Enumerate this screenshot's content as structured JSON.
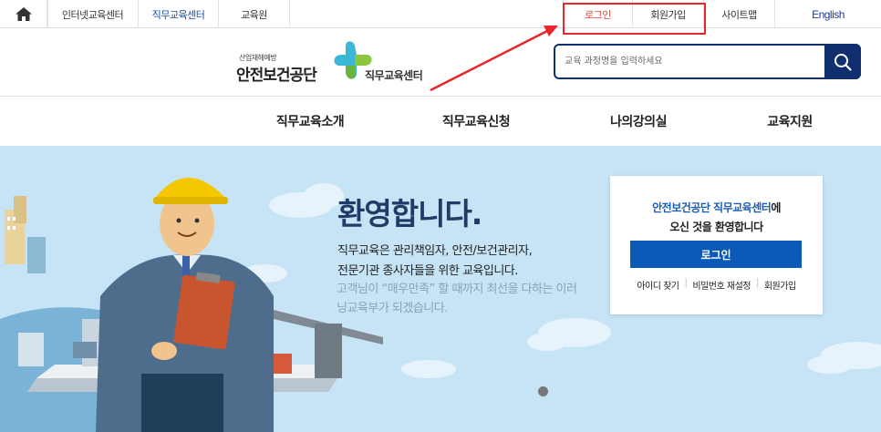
{
  "topbar": {
    "links_left": [
      "인터넷교육센터",
      "직무교육센터",
      "교육원"
    ],
    "login": "로그인",
    "join": "회원가입",
    "sitemap": "사이트맵",
    "english": "English"
  },
  "header": {
    "logo_small": "산업재해예방",
    "logo_main": "안전보건공단",
    "logo_sub": "직무교육센터",
    "search_placeholder": "교육 과정명을 입력하세요"
  },
  "nav": [
    "직무교육소개",
    "직무교육신청",
    "나의강의실",
    "교육지원"
  ],
  "hero": {
    "title": "환영합니다.",
    "line1": "직무교육은 관리책임자, 안전/보건관리자,",
    "line2": "전문기관 종사자들을 위한 교육입니다.",
    "faint1": "고객님이 “매우만족” 할 때까지 최선을 다하는 이러",
    "faint2": "닝교육부가 되겠습니다."
  },
  "login_panel": {
    "line1_blue": "안전보건공단 직무교육센터",
    "line1_rest": "에",
    "line2": "오신 것을 환영합니다",
    "button": "로그인",
    "links": [
      "아이디 찾기",
      "비밀번호 재설정",
      "회원가입"
    ]
  },
  "colors": {
    "accent_navy": "#0f2f6e",
    "login_red": "#e04a3a",
    "highlight_red": "#e8262b",
    "hero_bg": "#c6e4f5",
    "button_blue": "#0b5ab8"
  }
}
